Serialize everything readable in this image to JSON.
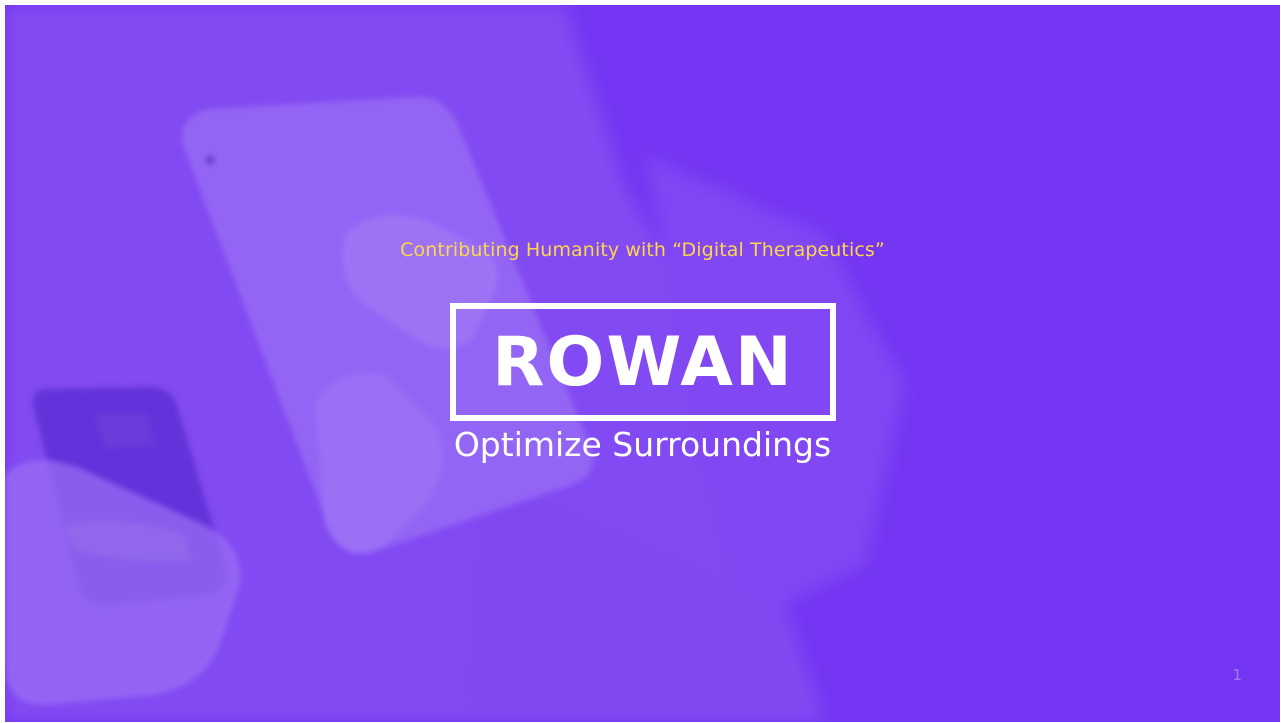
{
  "slide": {
    "tagline": "Contributing Humanity with “Digital Therapeutics”",
    "logo": "ROWAN",
    "subtitle": "Optimize Surroundings",
    "page_number": "1"
  },
  "colors": {
    "background": "#7436f2",
    "tagline": "#ffd54a",
    "text": "#ffffff",
    "page_number": "#a07ef0"
  },
  "background_image": "hands-holding-tablet-and-phone-photo"
}
